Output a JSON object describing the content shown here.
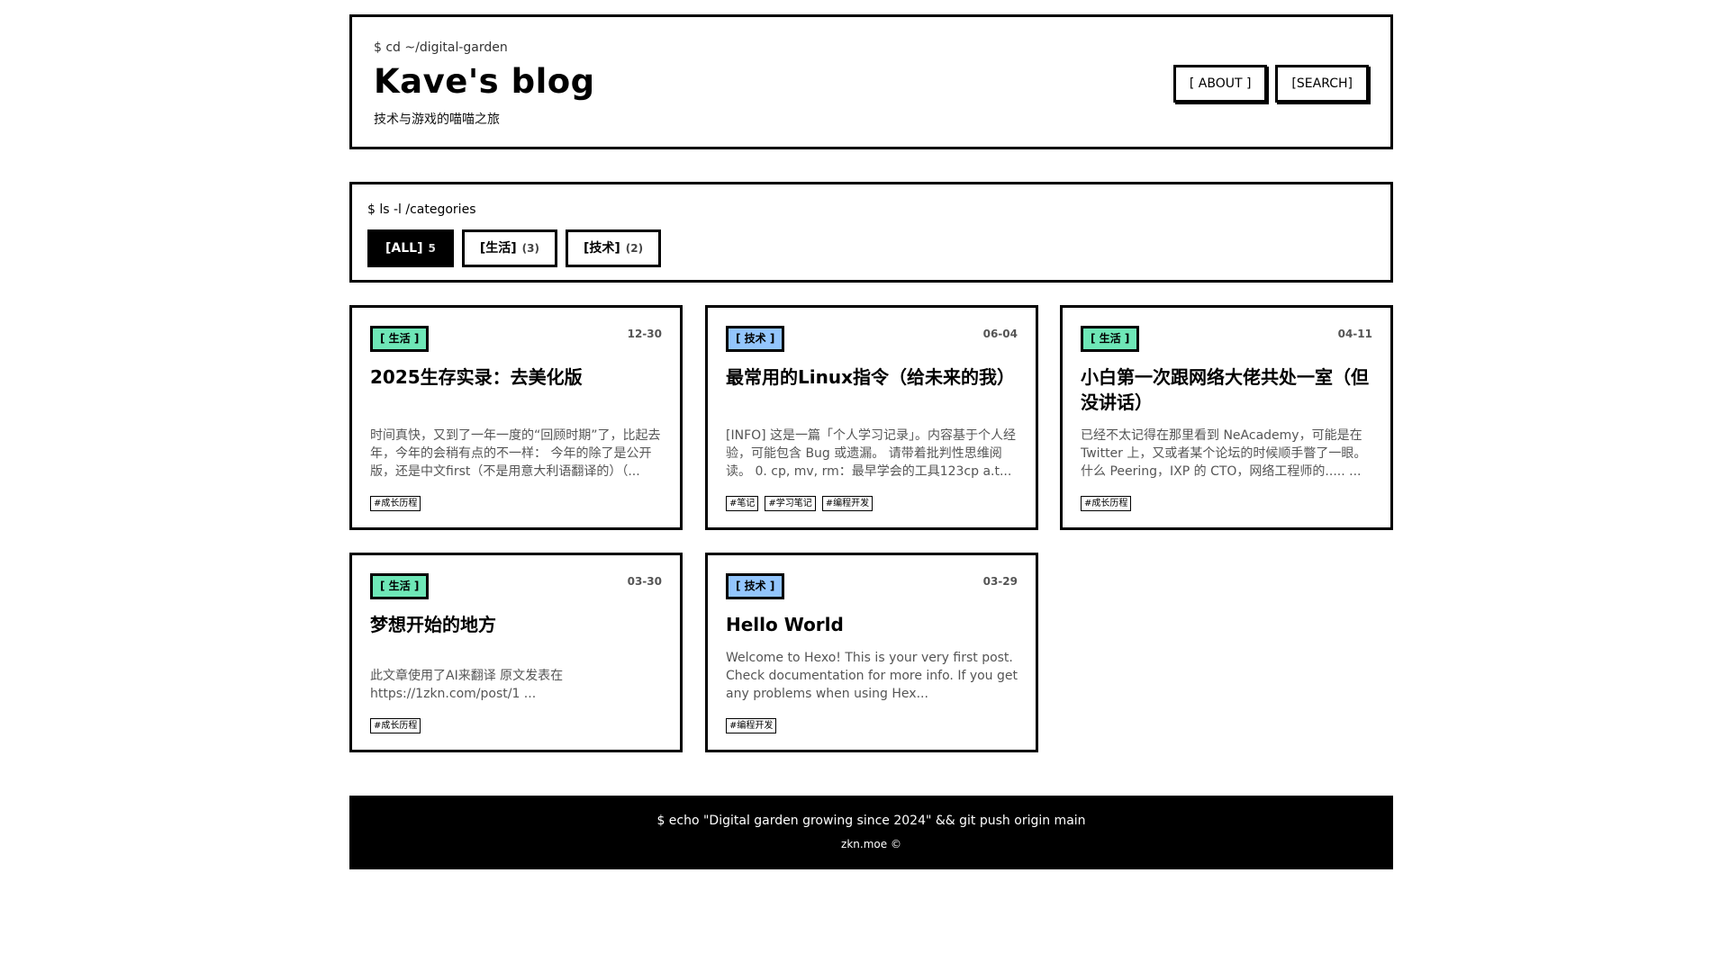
{
  "header": {
    "cmd": "$ cd ~/digital-garden",
    "title": "Kave's blog",
    "subtitle": "技术与游戏的喵喵之旅",
    "nav": [
      {
        "label": "[ ABOUT ]"
      },
      {
        "label": "[SEARCH]"
      }
    ]
  },
  "categories": {
    "cmd": "$ ls -l /categories",
    "filters": [
      {
        "label": "[ALL]",
        "count": "5"
      },
      {
        "label": "[生活]",
        "count": "(3)"
      },
      {
        "label": "[技术]",
        "count": "(2)"
      }
    ]
  },
  "posts": [
    {
      "category": "[ 生活 ]",
      "date": "12-30",
      "title": "2025生存实录：去美化版",
      "excerpt": "时间真快，又到了一年一度的“回顾时期”了，比起去年，今年的会稍有点的不一样： 今年的除了是公开版，还是中文first（不是用意大利语翻译的）（...",
      "tags": [
        "#成长历程"
      ]
    },
    {
      "category": "[ 技术 ]",
      "date": "06-04",
      "title": "最常用的Linux指令（给未来的我）",
      "excerpt": "[INFO] 这是一篇「个人学习记录」。内容基于个人经验，可能包含 Bug 或遗漏。 请带着批判性思维阅读。 0. cp, mv, rm：最早学会的工具123cp a.t...",
      "tags": [
        "#笔记",
        "#学习笔记",
        "#编程开发"
      ]
    },
    {
      "category": "[ 生活 ]",
      "date": "04-11",
      "title": "小白第一次跟网络大佬共处一室（但没讲话）",
      "excerpt": "已经不太记得在那里看到 NeAcademy，可能是在 Twitter 上，又或者某个论坛的时候顺手瞥了一眼。什么 Peering，IXP 的 CTO，网络工程师的..... ...",
      "tags": [
        "#成长历程"
      ]
    },
    {
      "category": "[ 生活 ]",
      "date": "03-30",
      "title": "梦想开始的地方",
      "excerpt": "此文章使用了AI来翻译 原文发表在 https://1zkn.com/post/1 ...",
      "tags": [
        "#成长历程"
      ]
    },
    {
      "category": "[ 技术 ]",
      "date": "03-29",
      "title": "Hello World",
      "excerpt": "Welcome to Hexo! This is your very first post. Check documentation for more info. If you get any problems when using Hex...",
      "tags": [
        "#编程开发"
      ]
    }
  ],
  "footer": {
    "line1": "$ echo \"Digital garden growing since 2024\" && git push origin main",
    "line2": "zkn.moe ©"
  }
}
